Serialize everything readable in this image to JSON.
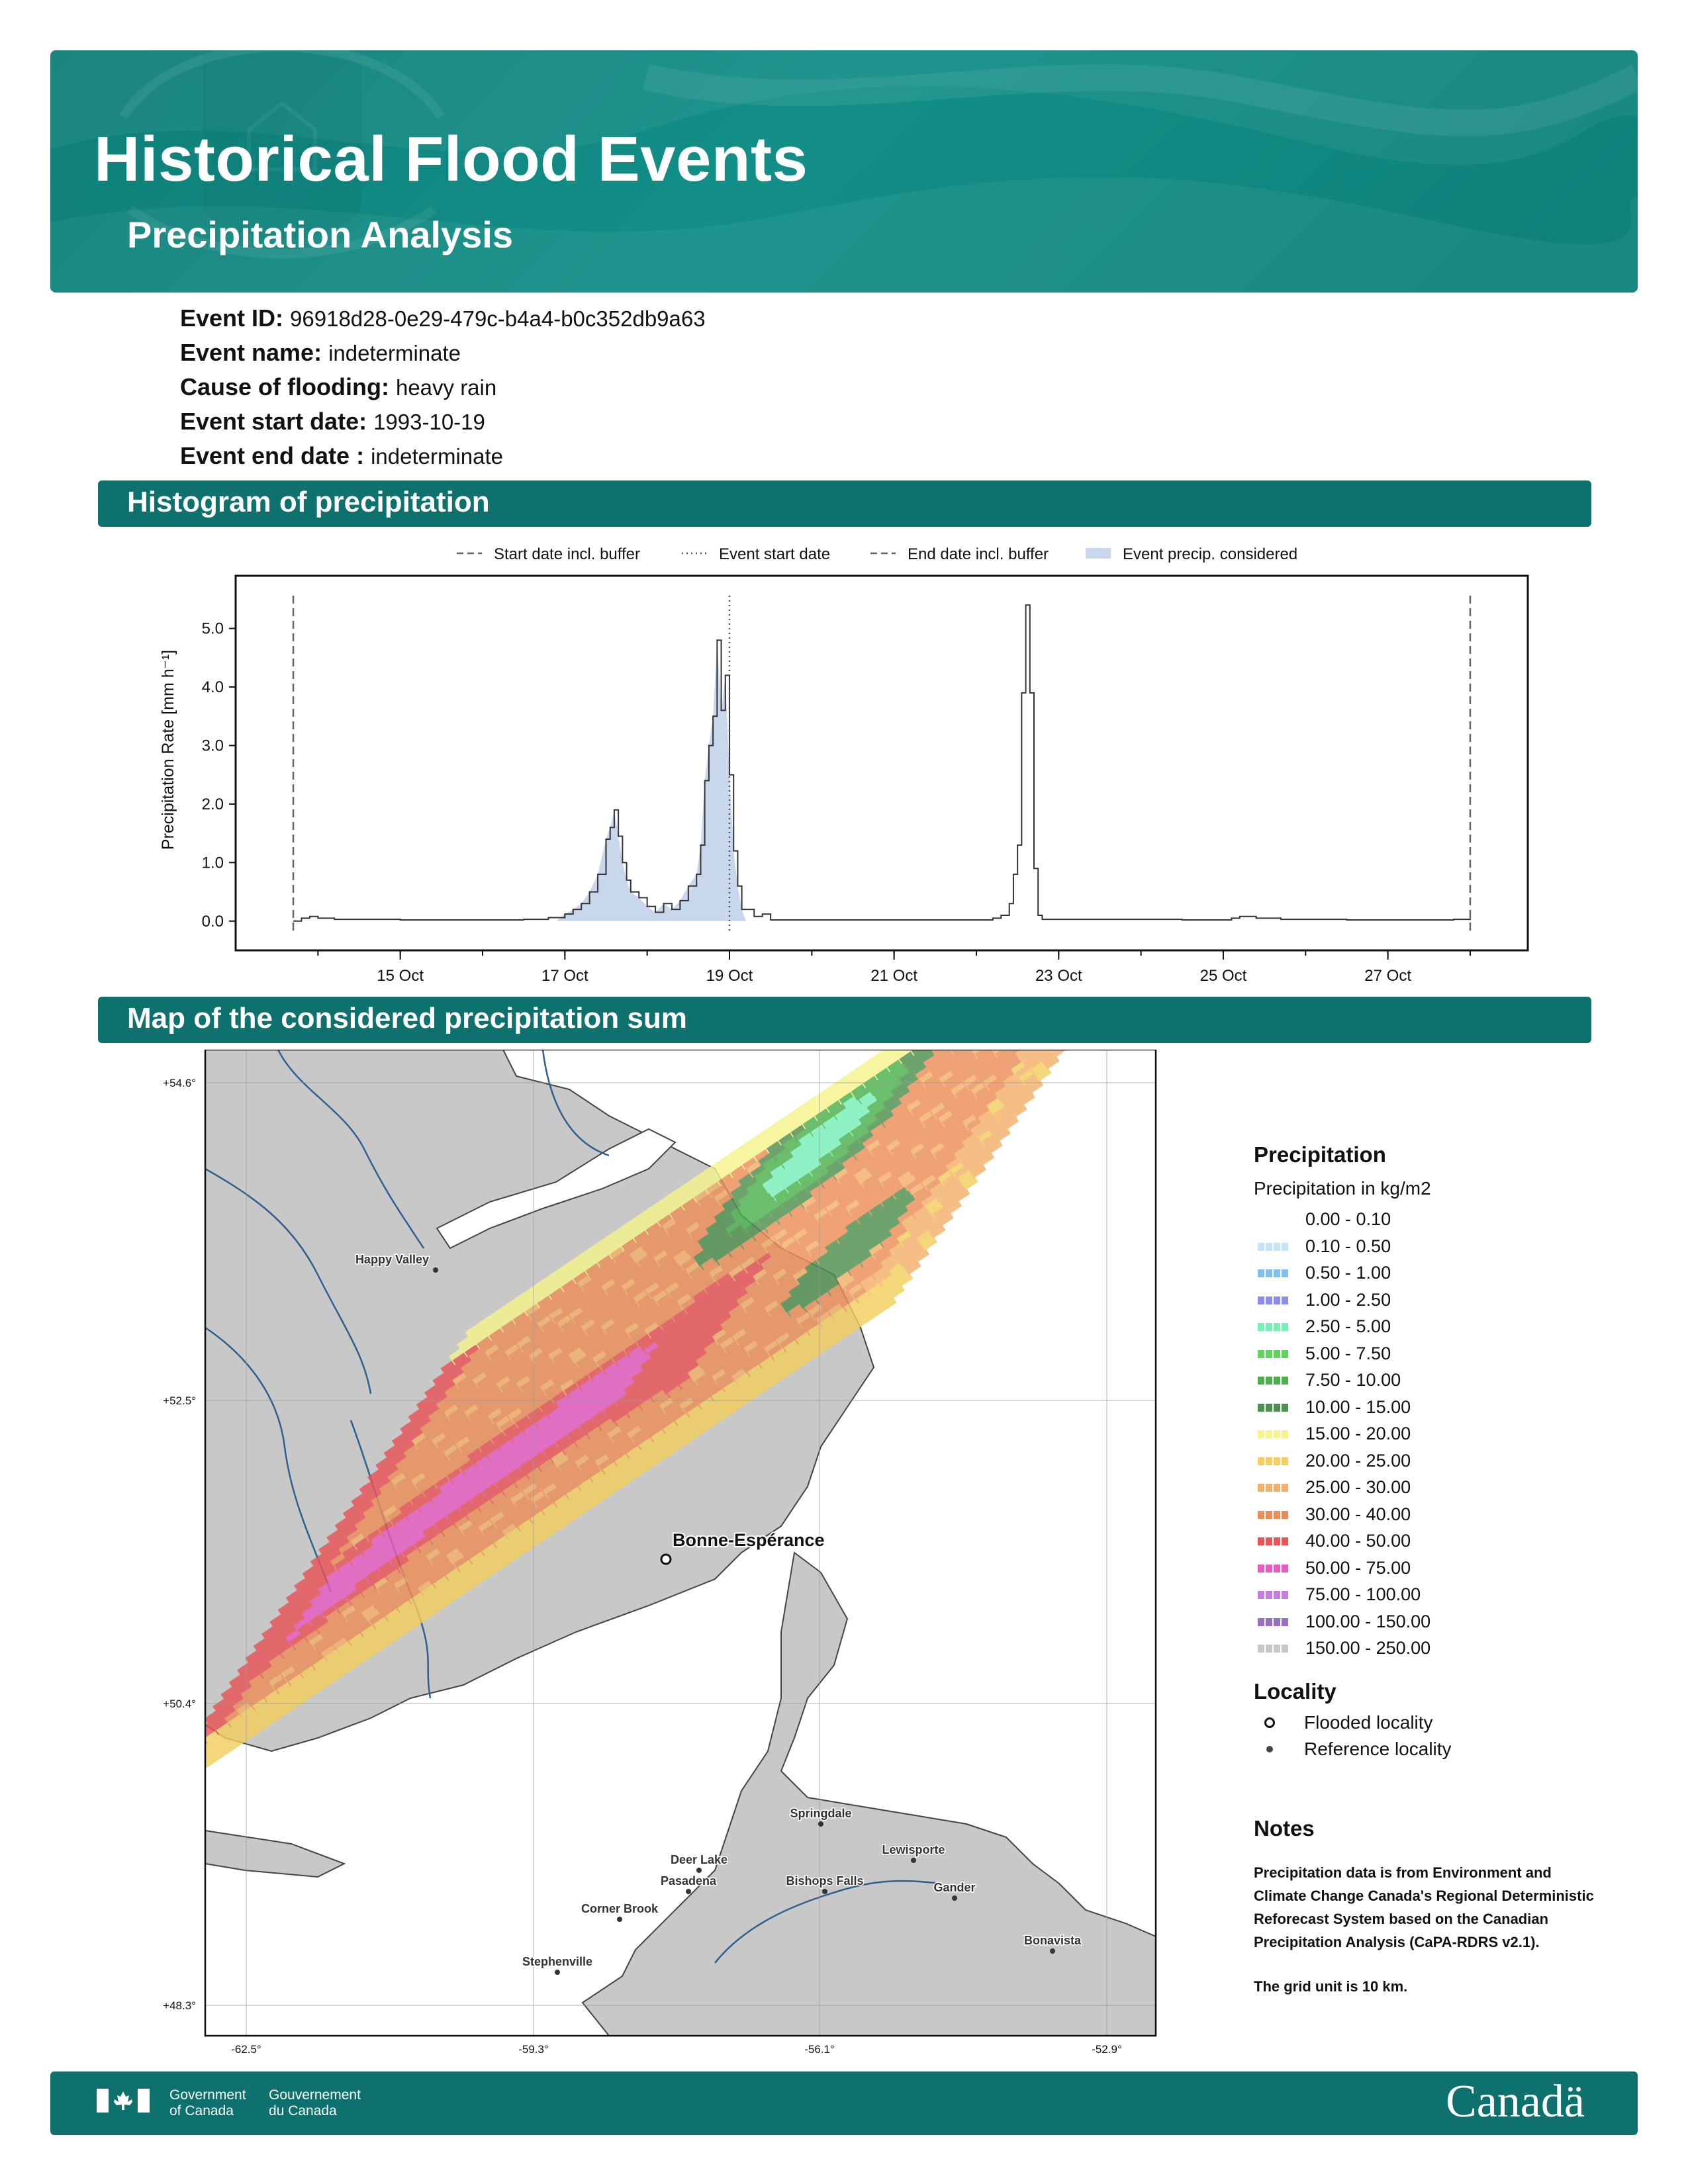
{
  "header": {
    "title": "Historical Flood Events",
    "subtitle": "Precipitation Analysis"
  },
  "event": [
    {
      "key": "Event ID:",
      "value": "96918d28-0e29-479c-b4a4-b0c352db9a63"
    },
    {
      "key": "Event name:",
      "value": "indeterminate"
    },
    {
      "key": "Cause of flooding:",
      "value": "heavy rain"
    },
    {
      "key": "Event start date:",
      "value": "1993-10-19"
    },
    {
      "key": "Event end date :",
      "value": "indeterminate"
    }
  ],
  "sections": {
    "histogram": "Histogram of precipitation",
    "map": "Map of the considered precipitation sum"
  },
  "chart_data": {
    "type": "area",
    "title": "",
    "ylabel": "Precipitation Rate [mm h⁻¹]",
    "xlabel": "",
    "ylim": [
      -0.5,
      5.9
    ],
    "yticks": [
      "0.0",
      "1.0",
      "2.0",
      "3.0",
      "4.0",
      "5.0"
    ],
    "xticks": [
      "15 Oct",
      "17 Oct",
      "19 Oct",
      "21 Oct",
      "23 Oct",
      "25 Oct",
      "27 Oct"
    ],
    "xrange_days": [
      13.0,
      28.7
    ],
    "legend": [
      "Start date incl. buffer",
      "Event start date",
      "End date incl. buffer",
      "Event precip. considered"
    ],
    "legend_position": "top",
    "markers": {
      "start_buffer": 13.7,
      "event_start": 19.0,
      "end_buffer": 28.0
    },
    "shaded_range": [
      16.9,
      19.2
    ],
    "series": [
      {
        "name": "Precipitation rate",
        "points": [
          [
            13.7,
            0.0
          ],
          [
            13.8,
            0.05
          ],
          [
            13.9,
            0.08
          ],
          [
            14.0,
            0.05
          ],
          [
            14.2,
            0.03
          ],
          [
            15.0,
            0.02
          ],
          [
            16.0,
            0.02
          ],
          [
            16.5,
            0.03
          ],
          [
            16.8,
            0.06
          ],
          [
            17.0,
            0.12
          ],
          [
            17.1,
            0.2
          ],
          [
            17.2,
            0.3
          ],
          [
            17.3,
            0.5
          ],
          [
            17.4,
            0.8
          ],
          [
            17.5,
            1.4
          ],
          [
            17.55,
            1.6
          ],
          [
            17.6,
            1.9
          ],
          [
            17.65,
            1.45
          ],
          [
            17.7,
            1.0
          ],
          [
            17.75,
            0.7
          ],
          [
            17.8,
            0.5
          ],
          [
            17.9,
            0.4
          ],
          [
            18.0,
            0.25
          ],
          [
            18.1,
            0.15
          ],
          [
            18.2,
            0.3
          ],
          [
            18.3,
            0.2
          ],
          [
            18.4,
            0.35
          ],
          [
            18.5,
            0.6
          ],
          [
            18.6,
            0.8
          ],
          [
            18.65,
            1.3
          ],
          [
            18.7,
            2.4
          ],
          [
            18.75,
            3.0
          ],
          [
            18.8,
            3.5
          ],
          [
            18.85,
            4.8
          ],
          [
            18.9,
            3.6
          ],
          [
            18.95,
            4.2
          ],
          [
            19.0,
            2.5
          ],
          [
            19.05,
            1.2
          ],
          [
            19.1,
            0.6
          ],
          [
            19.15,
            0.2
          ],
          [
            19.3,
            0.08
          ],
          [
            19.4,
            0.12
          ],
          [
            19.5,
            0.02
          ],
          [
            20.0,
            0.02
          ],
          [
            21.0,
            0.02
          ],
          [
            22.0,
            0.02
          ],
          [
            22.2,
            0.05
          ],
          [
            22.3,
            0.1
          ],
          [
            22.4,
            0.3
          ],
          [
            22.45,
            0.8
          ],
          [
            22.5,
            1.3
          ],
          [
            22.55,
            3.9
          ],
          [
            22.6,
            5.4
          ],
          [
            22.65,
            3.9
          ],
          [
            22.7,
            0.9
          ],
          [
            22.75,
            0.1
          ],
          [
            22.8,
            0.03
          ],
          [
            23.5,
            0.03
          ],
          [
            24.5,
            0.02
          ],
          [
            25.1,
            0.05
          ],
          [
            25.2,
            0.08
          ],
          [
            25.4,
            0.05
          ],
          [
            25.7,
            0.03
          ],
          [
            26.5,
            0.02
          ],
          [
            27.5,
            0.02
          ],
          [
            27.8,
            0.03
          ],
          [
            28.0,
            0.05
          ]
        ]
      }
    ]
  },
  "map": {
    "lat_labels": [
      "+54.6°",
      "+52.5°",
      "+50.4°",
      "+48.3°"
    ],
    "lon_labels": [
      "-62.5°",
      "-59.3°",
      "-56.1°",
      "-52.9°"
    ],
    "flooded_locality": "Bonne-Espérance",
    "reference_localities": [
      "Happy Valley",
      "Springdale",
      "Lewisporte",
      "Deer Lake",
      "Pasadena",
      "Bishops Falls",
      "Gander",
      "Corner Brook",
      "Bonavista",
      "Stephenville"
    ]
  },
  "legend": {
    "title": "Precipitation",
    "subtitle": "Precipitation in kg/m2",
    "classes": [
      {
        "label": "0.00 - 0.10",
        "color": "#ffffff"
      },
      {
        "label": "0.10 - 0.50",
        "color": "#c6e3f7"
      },
      {
        "label": "0.50 - 1.00",
        "color": "#7fc0ee"
      },
      {
        "label": "1.00 - 2.50",
        "color": "#8b8ee8"
      },
      {
        "label": "2.50 - 5.00",
        "color": "#77f0b8"
      },
      {
        "label": "5.00 - 7.50",
        "color": "#5fd45f"
      },
      {
        "label": "7.50 - 10.00",
        "color": "#4bb04b"
      },
      {
        "label": "10.00 - 15.00",
        "color": "#4f8f4f"
      },
      {
        "label": "15.00 - 20.00",
        "color": "#f6f48c"
      },
      {
        "label": "20.00 - 25.00",
        "color": "#f2cf5e"
      },
      {
        "label": "25.00 - 30.00",
        "color": "#f2b06a"
      },
      {
        "label": "30.00 - 40.00",
        "color": "#ec8e59"
      },
      {
        "label": "40.00 - 50.00",
        "color": "#e85457"
      },
      {
        "label": "50.00 - 75.00",
        "color": "#e65cc4"
      },
      {
        "label": "75.00 - 100.00",
        "color": "#c47ee0"
      },
      {
        "label": "100.00 - 150.00",
        "color": "#9a6fbf"
      },
      {
        "label": "150.00 - 250.00",
        "color": "#c8c8c8"
      }
    ],
    "locality_title": "Locality",
    "flooded_label": "Flooded locality",
    "reference_label": "Reference locality"
  },
  "notes": {
    "title": "Notes",
    "p1": "Precipitation data is from Environment and Climate Change Canada's Regional Deterministic Reforecast System based on the Canadian Precipitation Analysis (CaPA-RDRS v2.1).",
    "p2": "The grid unit is 10 km."
  },
  "footer": {
    "gov_en_1": "Government",
    "gov_en_2": "of Canada",
    "gov_fr_1": "Gouvernement",
    "gov_fr_2": "du Canada",
    "wordmark": "Canadä"
  },
  "colors": {
    "banner": "#0f8580",
    "bar": "#0f716d",
    "shade": "#c9d7ec"
  }
}
